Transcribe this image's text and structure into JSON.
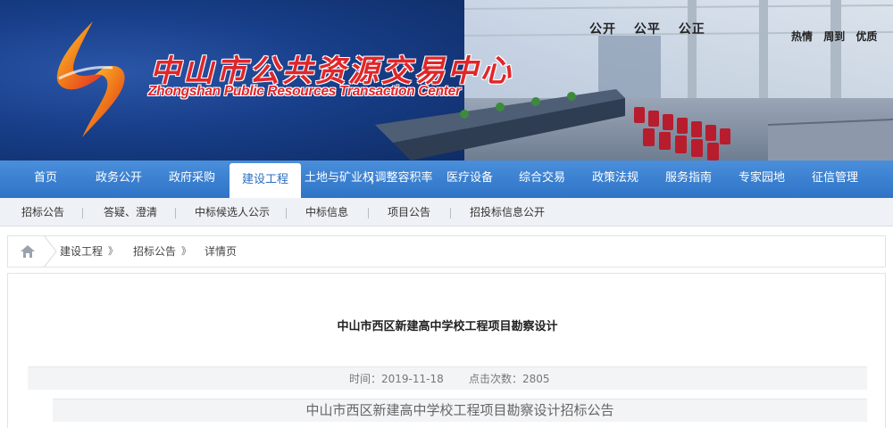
{
  "banner": {
    "title_cn": "中山市公共资源交易中心",
    "title_en": "Zhongshan Public Resources Transaction Center",
    "slogans": [
      "公开",
      "公平",
      "公正"
    ],
    "slogans2": [
      "热情",
      "周到",
      "优质"
    ]
  },
  "nav": {
    "items": [
      {
        "label": "首页"
      },
      {
        "label": "政务公开"
      },
      {
        "label": "政府采购"
      },
      {
        "label": "建设工程"
      },
      {
        "label": "土地与矿业权"
      },
      {
        "label": "调整容积率"
      },
      {
        "label": "医疗设备"
      },
      {
        "label": "综合交易"
      },
      {
        "label": "政策法规"
      },
      {
        "label": "服务指南"
      },
      {
        "label": "专家园地"
      },
      {
        "label": "征信管理"
      }
    ],
    "active_index": 3
  },
  "subnav": {
    "items": [
      {
        "label": "招标公告"
      },
      {
        "label": "答疑、澄清"
      },
      {
        "label": "中标候选人公示"
      },
      {
        "label": "中标信息"
      },
      {
        "label": "项目公告"
      },
      {
        "label": "招投标信息公开"
      }
    ]
  },
  "breadcrumb": {
    "items": [
      "建设工程",
      "招标公告",
      "详情页"
    ],
    "separator": "》"
  },
  "article": {
    "title": "中山市西区新建高中学校工程项目勘察设计",
    "time_label": "时间：2019-11-18",
    "views_label": "点击次数：2805",
    "subtitle": "中山市西区新建高中学校工程项目勘察设计招标公告"
  },
  "colors": {
    "nav_bg": "#2e73c6",
    "nav_active_text": "#2c6ec1",
    "title_red": "#e0262a"
  }
}
